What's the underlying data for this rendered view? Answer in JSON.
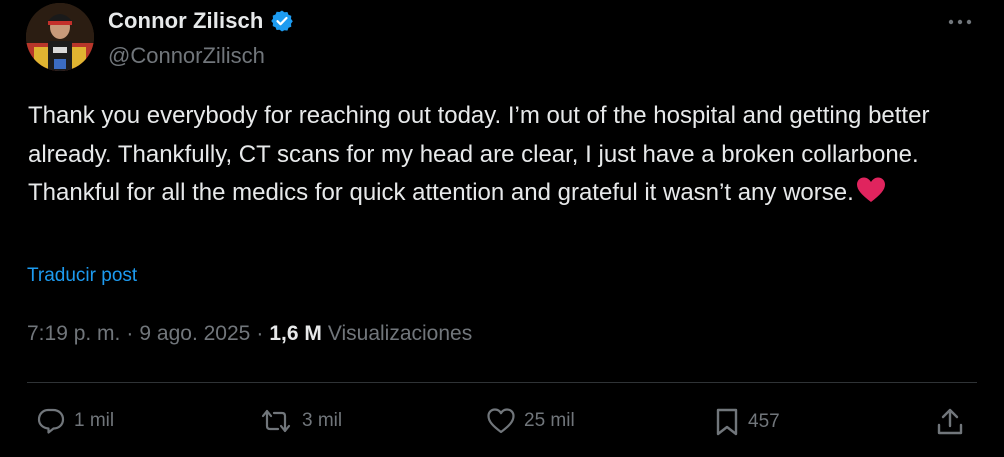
{
  "author": {
    "display_name": "Connor Zilisch",
    "handle": "@ConnorZilisch",
    "verified": true
  },
  "icons": {
    "verified": "verified-badge-icon",
    "more": "more-options-icon",
    "reply": "reply-icon",
    "repost": "repost-icon",
    "like": "like-icon",
    "bookmark": "bookmark-icon",
    "share": "share-icon",
    "heart_emoji": "red-heart-emoji"
  },
  "post": {
    "text": "Thank you everybody for reaching out today. I’m out of the hospital and getting better already. Thankfully, CT scans for my head are clear, I just have a broken collarbone. Thankful for all the medics for quick attention and grateful it wasn’t any worse.",
    "translate_label": "Traducir post"
  },
  "meta": {
    "time": "7:19 p. m.",
    "separator": "·",
    "date": "9 ago. 2025",
    "views_count": "1,6 M",
    "views_label": "Visualizaciones"
  },
  "actions": {
    "replies": "1 mil",
    "reposts": "3 mil",
    "likes": "25 mil",
    "bookmarks": "457"
  },
  "colors": {
    "background": "#000000",
    "text": "#e7e9ea",
    "muted": "#71767b",
    "link": "#1d9bf0",
    "verified": "#1d9bf0",
    "heart": "#e0245e",
    "divider": "#2f3336"
  }
}
